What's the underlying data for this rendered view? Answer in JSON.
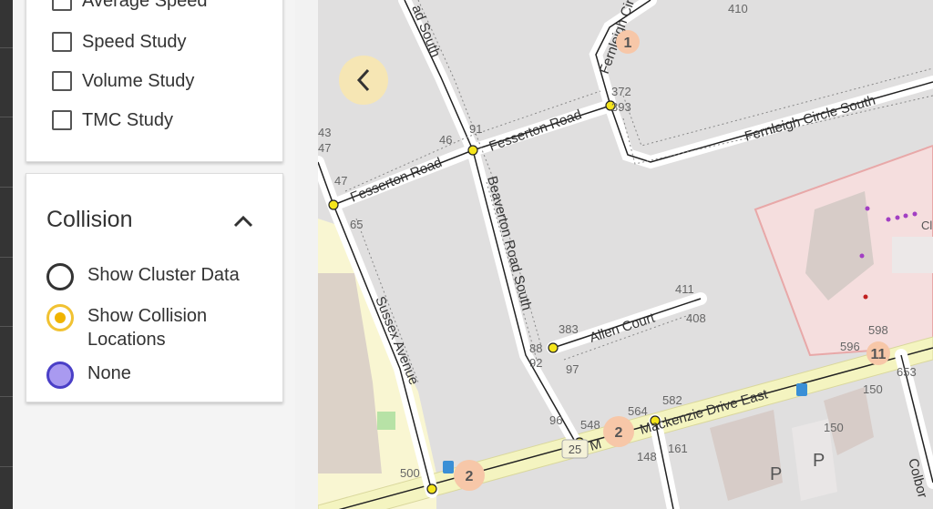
{
  "studies": {
    "items": [
      {
        "label": "Average Speed",
        "checked": false
      },
      {
        "label": "Speed Study",
        "checked": false
      },
      {
        "label": "Volume Study",
        "checked": false
      },
      {
        "label": "TMC Study",
        "checked": false
      }
    ]
  },
  "collision": {
    "title": "Collision",
    "options": [
      {
        "label": "Show Cluster Data",
        "selected": false
      },
      {
        "label": "Show Collision Locations",
        "selected": false
      },
      {
        "label": "None",
        "selected": true
      }
    ]
  },
  "map": {
    "streets": {
      "beaverton": "Beaverton Road South",
      "fesserton_left": "Fesserton Road",
      "fesserton_right": "Fesserton Road",
      "fernleigh_north": "Fernleigh Circle North",
      "fernleigh_south": "Fernleigh Circle South",
      "allen": "Allen Court",
      "sussex": "Sussex Avenue",
      "mackenzie": "Mackenzie Drive East",
      "partial_top": "ad South",
      "partial_m": "M",
      "partial_right": "Colbor"
    },
    "address_numbers": [
      "410",
      "372",
      "393",
      "91",
      "46",
      "43",
      "47",
      "47",
      "65",
      "411",
      "408",
      "383",
      "88",
      "92",
      "97",
      "96",
      "548",
      "564",
      "582",
      "161",
      "148",
      "150",
      "150",
      "598",
      "596",
      "653",
      "500"
    ],
    "cluster_markers": [
      "1",
      "2",
      "2",
      "11"
    ],
    "route_badge": "25",
    "poi_label": "Cl",
    "colors": {
      "cluster_fill": "#f7c7a8",
      "cluster_text": "#e1313b",
      "signal": "#f5e51c",
      "highway": "#f4f4c0",
      "park": "#f9f6d2"
    }
  },
  "accent_colors": {
    "radio_selected": "#4a3fc7",
    "radio_yellow": "#f1c232",
    "back_button": "#f6e6b4"
  }
}
